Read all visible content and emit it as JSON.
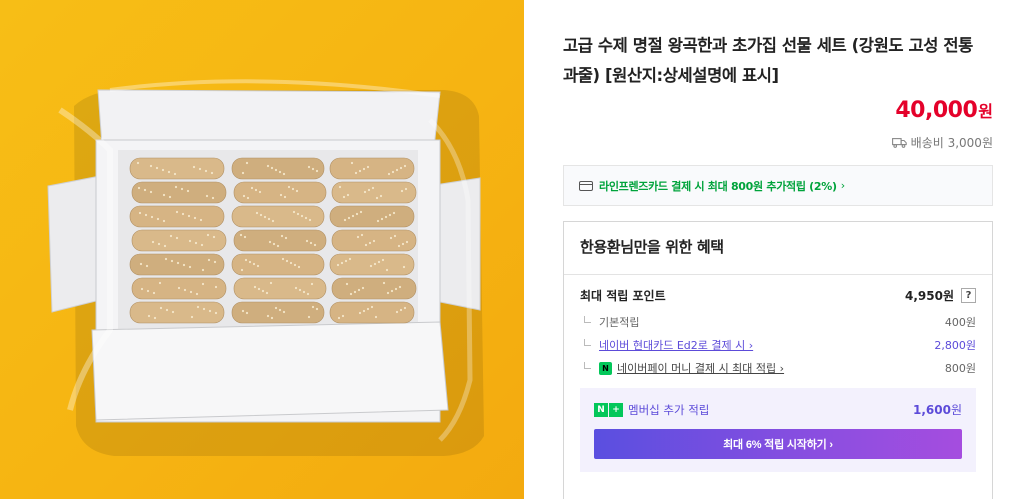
{
  "product": {
    "image_alt": "hangwa-gift-box-photo",
    "title": "고급 수제 명절 왕곡한과 초가집 선물 세트 (강원도 고성 전통 과줄) [원산지:상세설명에 표시]",
    "price": {
      "amount": "40,000",
      "unit": "원"
    },
    "shipping": {
      "icon": "truck-icon",
      "text": "배송비 3,000원"
    }
  },
  "card_promo": {
    "icon": "credit-card-icon",
    "text": "라인프렌즈카드 결제 시 최대 800원 추가적립 (2%)",
    "chevron": "›"
  },
  "benefits": {
    "title": "한용환님만을 위한 혜택",
    "max_points": {
      "label": "최대 적립 포인트",
      "value": "4,950원",
      "help": "?"
    },
    "items": [
      {
        "label": "기본적립",
        "value": "400원"
      },
      {
        "label": "네이버 현대카드 Ed2로 결제 시 ›",
        "value": "2,800원"
      },
      {
        "badge": "N",
        "label": "네이버페이 머니 결제 시 최대 적립 ›",
        "value": "800원"
      }
    ],
    "membership": {
      "badge_n": "N",
      "badge_plus": "+",
      "label": "멤버십 추가 적립",
      "value": "1,600",
      "unit": "원",
      "button": "최대 6% 적립 시작하기 ›"
    }
  },
  "colors": {
    "price_red": "#e4012a",
    "promo_green": "#00a33b",
    "naver_green": "#03c75a",
    "membership_purple": "#5c4bd9",
    "image_background": "#f6b412"
  }
}
